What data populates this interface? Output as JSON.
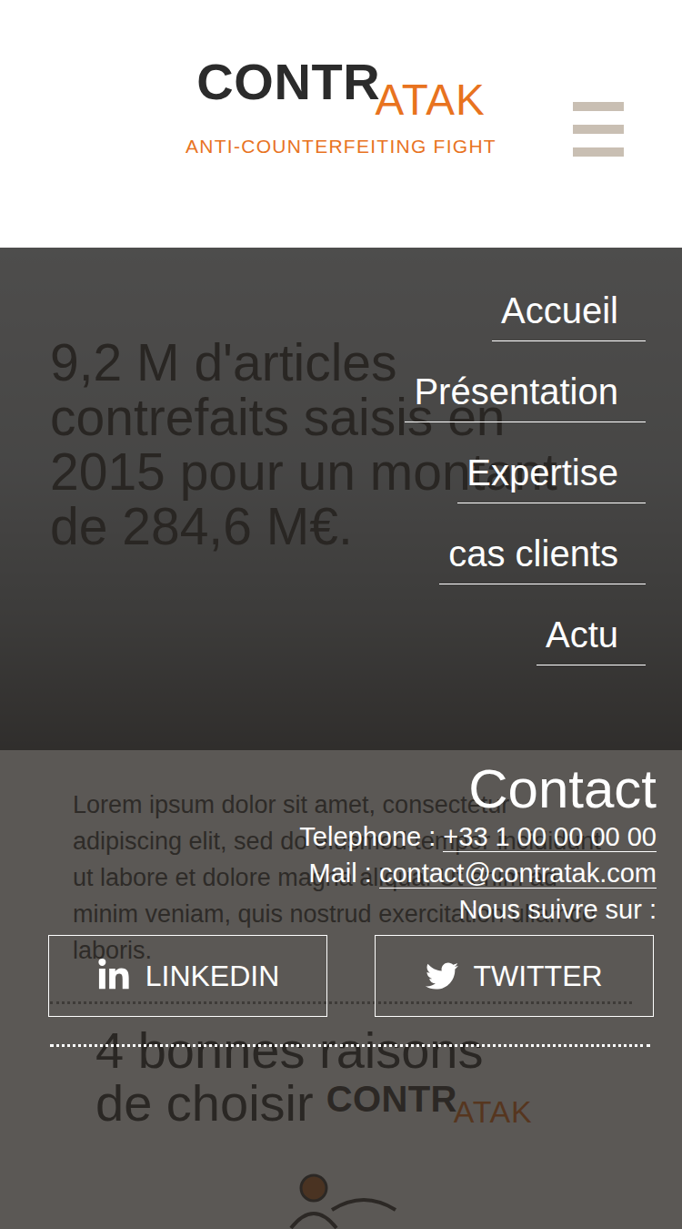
{
  "logo": {
    "word_dark": "CONTR",
    "word_orange": "ATAK",
    "tagline": "ANTI-COUNTERFEITING FIGHT"
  },
  "hero": {
    "headline": "9,2 M d'articles contrefaits saisis en 2015 pour un montant de 284,6 M€."
  },
  "intro": {
    "text": "Lorem ipsum dolor sit amet, consectetur adipiscing elit, sed do eiusmod tempor incididunt ut labore et dolore magna aliqua. Ut enim ad minim veniam, quis nostrud exercitation ullamco laboris."
  },
  "reasons": {
    "title_line1": "4 bonnes raisons",
    "title_line2": "de choisir"
  },
  "nav": {
    "items": [
      {
        "label": "Accueil"
      },
      {
        "label": "Présentation"
      },
      {
        "label": "Expertise"
      },
      {
        "label": "cas clients"
      },
      {
        "label": "Actu"
      }
    ]
  },
  "contact": {
    "title": "Contact",
    "phone_label": "Telephone : ",
    "phone": "+33 1 00 00 00 00",
    "mail_label": "Mail : ",
    "mail": "contact@contratak.com",
    "follow": "Nous suivre sur :"
  },
  "social": [
    {
      "label": "LINKEDIN",
      "kind": "linkedin"
    },
    {
      "label": "TWITTER",
      "kind": "twitter"
    }
  ]
}
